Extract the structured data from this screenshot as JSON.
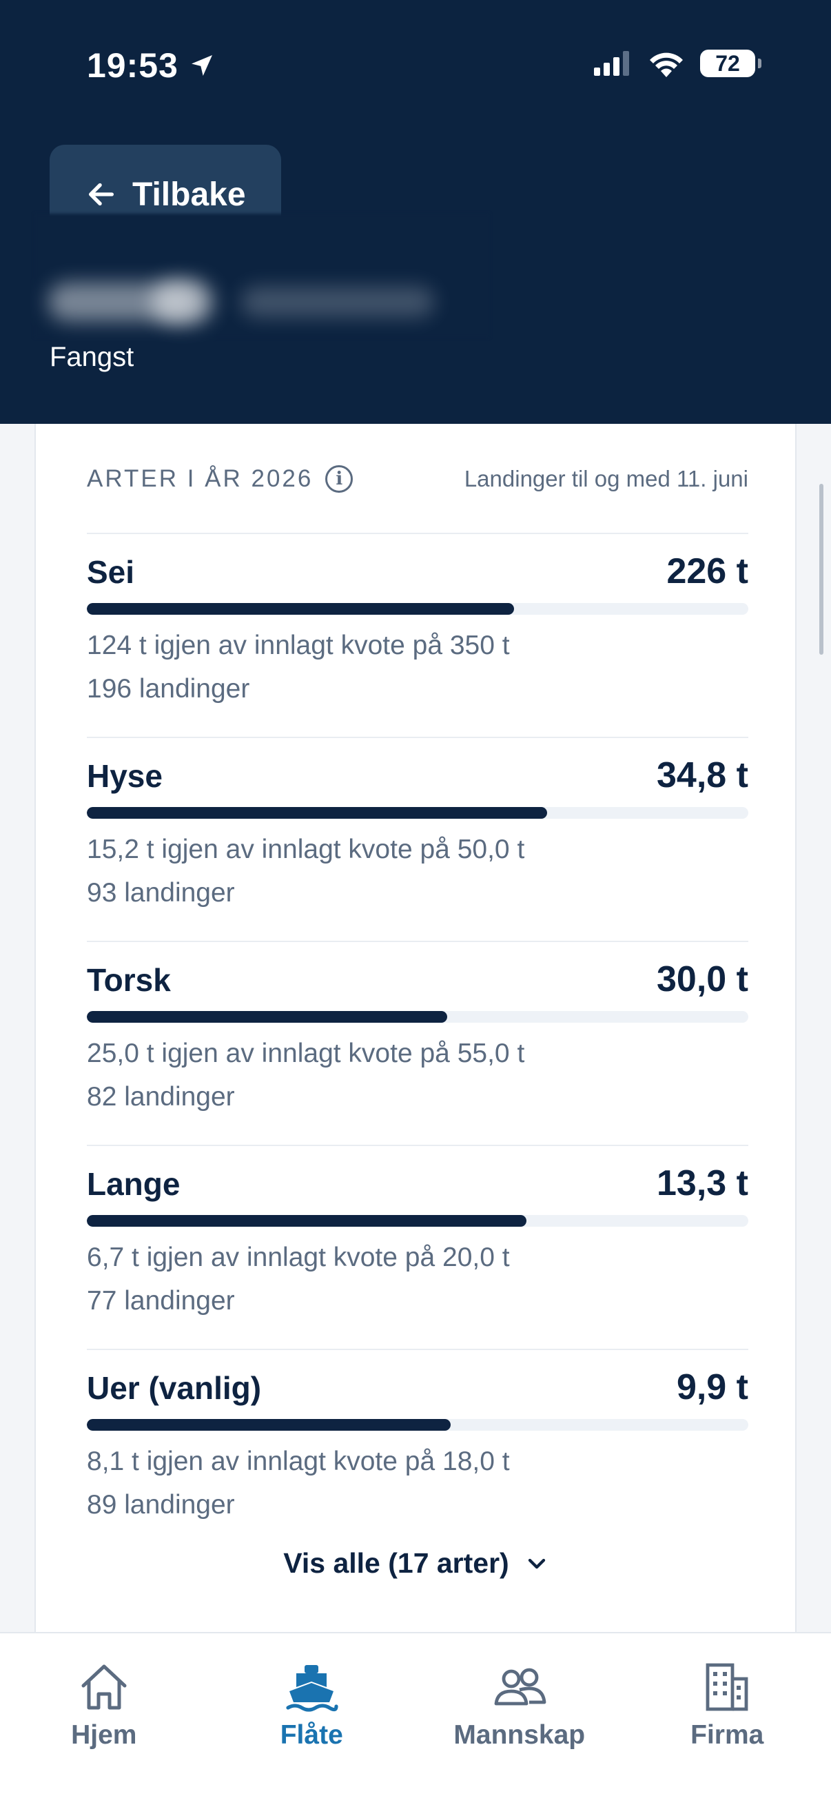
{
  "status_bar": {
    "time": "19:53",
    "battery": "72",
    "icons": [
      "location-arrow-icon",
      "cellular-signal-icon",
      "wifi-icon",
      "battery-icon"
    ]
  },
  "header": {
    "back_label": "Tilbake",
    "subtitle": "Fangst"
  },
  "section": {
    "title": "ARTER I ÅR 2026",
    "note": "Landinger til og med 11. juni"
  },
  "species": [
    {
      "name": "Sei",
      "amount": "226 t",
      "quota_text": "124 t igjen av innlagt kvote på 350 t",
      "landings": "196 landinger",
      "fill_fraction": 0.646
    },
    {
      "name": "Hyse",
      "amount": "34,8 t",
      "quota_text": "15,2 t igjen av innlagt kvote på 50,0 t",
      "landings": "93 landinger",
      "fill_fraction": 0.696
    },
    {
      "name": "Torsk",
      "amount": "30,0 t",
      "quota_text": "25,0 t igjen av innlagt kvote på 55,0 t",
      "landings": "82 landinger",
      "fill_fraction": 0.545
    },
    {
      "name": "Lange",
      "amount": "13,3 t",
      "quota_text": "6,7 t igjen av innlagt kvote på 20,0 t",
      "landings": "77 landinger",
      "fill_fraction": 0.665
    },
    {
      "name": "Uer (vanlig)",
      "amount": "9,9 t",
      "quota_text": "8,1 t igjen av innlagt kvote på 18,0 t",
      "landings": "89 landinger",
      "fill_fraction": 0.55
    }
  ],
  "show_all_label": "Vis alle (17 arter)",
  "tabs": [
    {
      "label": "Hjem",
      "icon": "home-icon",
      "active": false
    },
    {
      "label": "Flåte",
      "icon": "ship-icon",
      "active": true
    },
    {
      "label": "Mannskap",
      "icon": "people-icon",
      "active": false
    },
    {
      "label": "Firma",
      "icon": "building-icon",
      "active": false
    }
  ],
  "colors": {
    "header_bg": "#0c2340",
    "bar_fill": "#0e2341",
    "active_tab": "#1a73b0",
    "muted_text": "#5b6b80"
  }
}
